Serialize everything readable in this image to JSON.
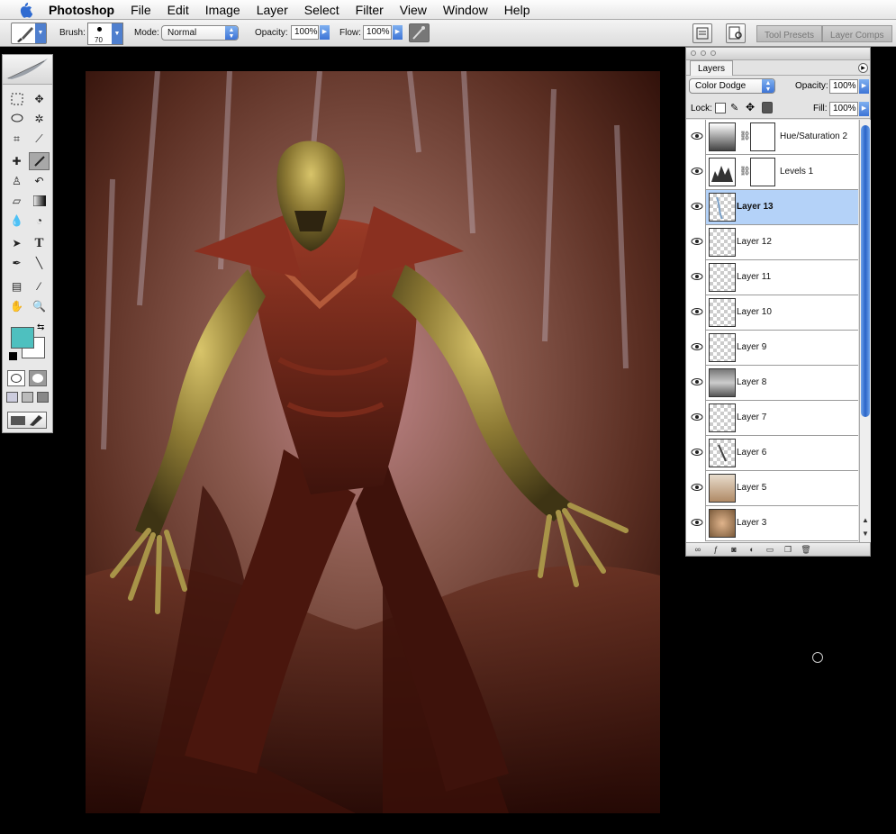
{
  "menubar": {
    "app": "Photoshop",
    "items": [
      "File",
      "Edit",
      "Image",
      "Layer",
      "Select",
      "Filter",
      "View",
      "Window",
      "Help"
    ]
  },
  "options": {
    "brush_label": "Brush:",
    "brush_size": "70",
    "mode_label": "Mode:",
    "mode_value": "Normal",
    "opacity_label": "Opacity:",
    "opacity_value": "100%",
    "flow_label": "Flow:",
    "flow_value": "100%",
    "tabs": [
      "Tool Presets",
      "Layer Comps"
    ]
  },
  "toolbox": {
    "fg_color": "#4ec0bf",
    "bg_color": "#ffffff"
  },
  "layers_panel": {
    "tab": "Layers",
    "blend_mode": "Color Dodge",
    "opacity_label": "Opacity:",
    "opacity_value": "100%",
    "lock_label": "Lock:",
    "fill_label": "Fill:",
    "fill_value": "100%",
    "layers": [
      {
        "name": "Hue/Saturation 2",
        "type": "adjustment",
        "active": false
      },
      {
        "name": "Levels 1",
        "type": "adjustment",
        "active": false
      },
      {
        "name": "Layer 13",
        "type": "pixel",
        "active": true
      },
      {
        "name": "Layer 12",
        "type": "pixel",
        "active": false
      },
      {
        "name": "Layer 11",
        "type": "pixel",
        "active": false
      },
      {
        "name": "Layer 10",
        "type": "pixel",
        "active": false
      },
      {
        "name": "Layer 9",
        "type": "pixel",
        "active": false
      },
      {
        "name": "Layer 8",
        "type": "pixel",
        "active": false
      },
      {
        "name": "Layer 7",
        "type": "pixel",
        "active": false
      },
      {
        "name": "Layer 6",
        "type": "pixel",
        "active": false
      },
      {
        "name": "Layer 5",
        "type": "pixel",
        "active": false
      },
      {
        "name": "Layer 3",
        "type": "pixel",
        "active": false
      }
    ]
  }
}
